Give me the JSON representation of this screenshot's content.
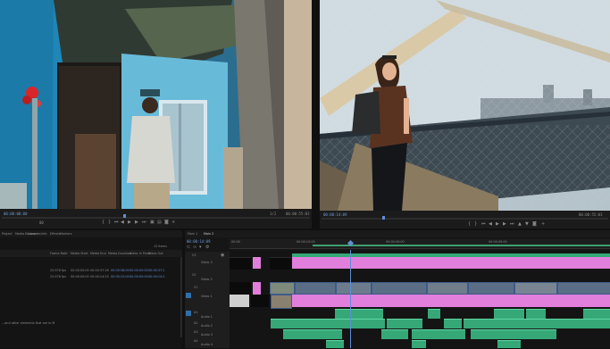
{
  "source_monitor": {
    "timecode_left": "00:00:00:00",
    "zoom": "1/2",
    "timecode_right": "00:00:55:03",
    "frame_marker": "00"
  },
  "program_monitor": {
    "timecode_left": "00:00:14:09",
    "timecode_right": "00:00:55:03"
  },
  "project": {
    "tabs": [
      "Project",
      "Media Browser",
      "Libraries",
      "Info",
      "Effects",
      "Markers"
    ],
    "item_count": "12 Items",
    "columns": [
      "Frame Rate",
      "Media Start",
      "Media End",
      "Media Duration",
      "Video In Point",
      "Video Out"
    ],
    "rows": [
      [
        "23.976 fps",
        "00:00:00:00",
        "00:00:37:18",
        "00:00:38:00",
        "00:00:00:00",
        "00:00:37:1"
      ],
      [
        "23.976 fps",
        "00:00:00:00",
        "00:00:14:23",
        "00:00:15:00",
        "00:00:00:00",
        "00:00:14:2"
      ]
    ],
    "footer_text": "...and other elements that are in M"
  },
  "timeline": {
    "tabs": [
      "Main 1",
      "Main 2"
    ],
    "timecode": "00:00:14:09",
    "ruler_labels": [
      "00:00",
      "00:00:15:00",
      "00:00:30:00",
      "00:00:45:00"
    ],
    "tracks": [
      "V3",
      "V2",
      "V1",
      "A1",
      "A2",
      "A3",
      "A4"
    ],
    "track_names": [
      "Video 3",
      "Video 2",
      "Video 1",
      "Audio 1",
      "Audio 2",
      "Audio 3",
      "Audio 4"
    ]
  },
  "colors": {
    "accent_blue": "#5e8fd6",
    "clip_pink": "#e27fdd",
    "clip_green": "#36a878",
    "playhead": "#5e8fd6"
  }
}
